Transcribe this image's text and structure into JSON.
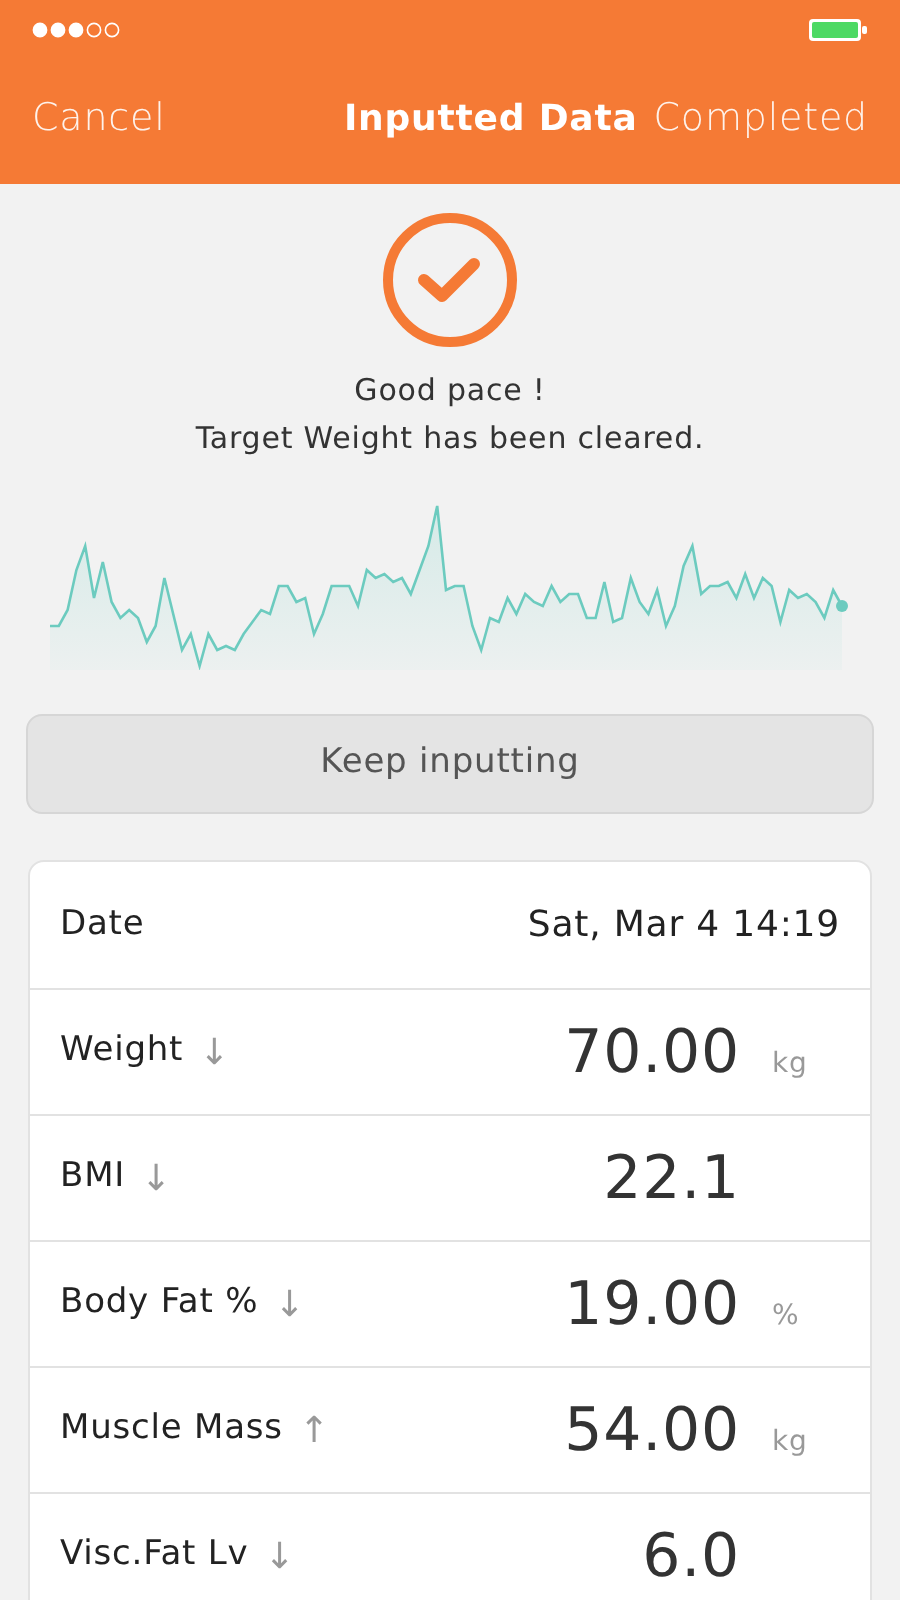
{
  "nav": {
    "cancel": "Cancel",
    "title": "Inputted Data",
    "done": "Completed"
  },
  "message": [
    "Good pace !",
    "Target Weight has been cleared."
  ],
  "button": "Keep inputting",
  "rows": [
    {
      "kind": "date",
      "label": "Date",
      "value": "Sat, Mar 4 14:19"
    },
    {
      "kind": "measure",
      "label": "Weight",
      "trend": "↓",
      "value": "70.00",
      "unit": "kg"
    },
    {
      "kind": "measure",
      "label": "BMI",
      "trend": "↓",
      "value": "22.1"
    },
    {
      "kind": "measure",
      "label": "Body Fat %",
      "trend": "↓",
      "value": "19.00",
      "unit": "%"
    },
    {
      "kind": "measure",
      "label": "Muscle Mass",
      "trend": "↑",
      "value": "54.00",
      "unit": "kg"
    },
    {
      "kind": "measure",
      "label": "Visc.Fat Lv",
      "trend": "↓",
      "value": "6.0"
    }
  ]
}
